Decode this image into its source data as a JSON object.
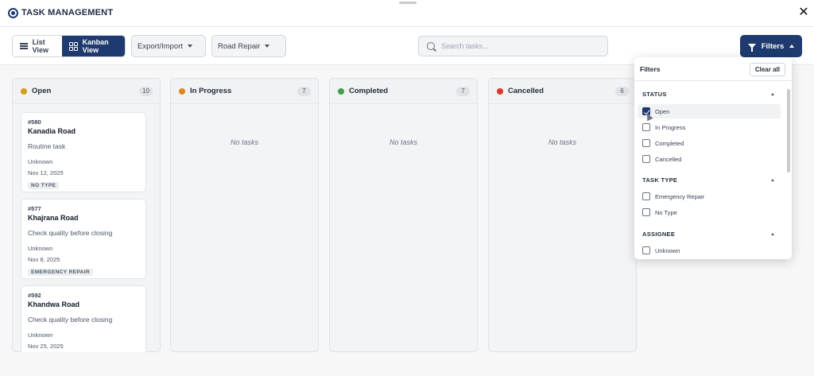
{
  "header": {
    "title": "TASK MANAGEMENT",
    "close": "✕"
  },
  "toolbar": {
    "list_view": "List View",
    "kanban_view": "Kanban View",
    "export_import": "Export/Import",
    "road_filter": "Road Repair",
    "search_placeholder": "Search tasks...",
    "filters": "Filters"
  },
  "columns": [
    {
      "title": "Open",
      "count": "10",
      "color": "#d4a017",
      "empty": ""
    },
    {
      "title": "In Progress",
      "count": "7",
      "color": "#d98a1e",
      "empty": "No tasks"
    },
    {
      "title": "Completed",
      "count": "7",
      "color": "#3fa047",
      "empty": "No tasks"
    },
    {
      "title": "Cancelled",
      "count": "6",
      "color": "#d9382e",
      "empty": "No tasks"
    }
  ],
  "cards": [
    {
      "id": "#580",
      "title": "Kanadia Road",
      "desc": "Routine task",
      "assignee": "Unknown",
      "date": "Nov 12, 2025",
      "type": "NO TYPE"
    },
    {
      "id": "#577",
      "title": "Khajrana Road",
      "desc": "Check quality before closing",
      "assignee": "Unknown",
      "date": "Nov 8, 2025",
      "type": "EMERGENCY REPAIR"
    },
    {
      "id": "#592",
      "title": "Khandwa Road",
      "desc": "Check quality before closing",
      "assignee": "Unknown",
      "date": "Nov 25, 2025",
      "type": ""
    }
  ],
  "filter_panel": {
    "title": "Filters",
    "clear_all": "Clear all",
    "sections": {
      "status": "STATUS",
      "task_type": "TASK TYPE",
      "assignee": "ASSIGNEE"
    },
    "status_options": [
      {
        "label": "Open",
        "checked": true
      },
      {
        "label": "In Progress",
        "checked": false
      },
      {
        "label": "Completed",
        "checked": false
      },
      {
        "label": "Cancelled",
        "checked": false
      }
    ],
    "type_options": [
      {
        "label": "Emergency Repair",
        "checked": false
      },
      {
        "label": "No Type",
        "checked": false
      }
    ],
    "assignee_options": [
      {
        "label": "Unknown",
        "checked": false
      }
    ]
  }
}
